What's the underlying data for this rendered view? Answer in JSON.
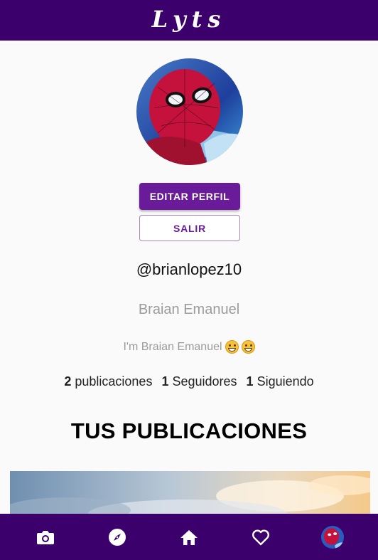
{
  "app": {
    "logo": "Lyts"
  },
  "profile": {
    "edit_label": "EDITAR PERFIL",
    "logout_label": "SALIR",
    "username": "@brianlopez10",
    "full_name": "Braian Emanuel",
    "bio": "I'm Braian Emanuel",
    "stats": {
      "posts_count": "2",
      "posts_label": "publicaciones",
      "followers_count": "1",
      "followers_label": "Seguidores",
      "following_count": "1",
      "following_label": "Siguiendo"
    }
  },
  "section": {
    "title": "TUS PUBLICACIONES"
  },
  "icons": {
    "bio_emoji": "grinning-face-emoji",
    "nav": [
      "camera-icon",
      "compass-icon",
      "home-icon",
      "heart-icon",
      "profile-avatar"
    ]
  },
  "colors": {
    "bar": "#3b006b",
    "accent": "#6a1b9a",
    "muted": "#9b9b9b"
  }
}
